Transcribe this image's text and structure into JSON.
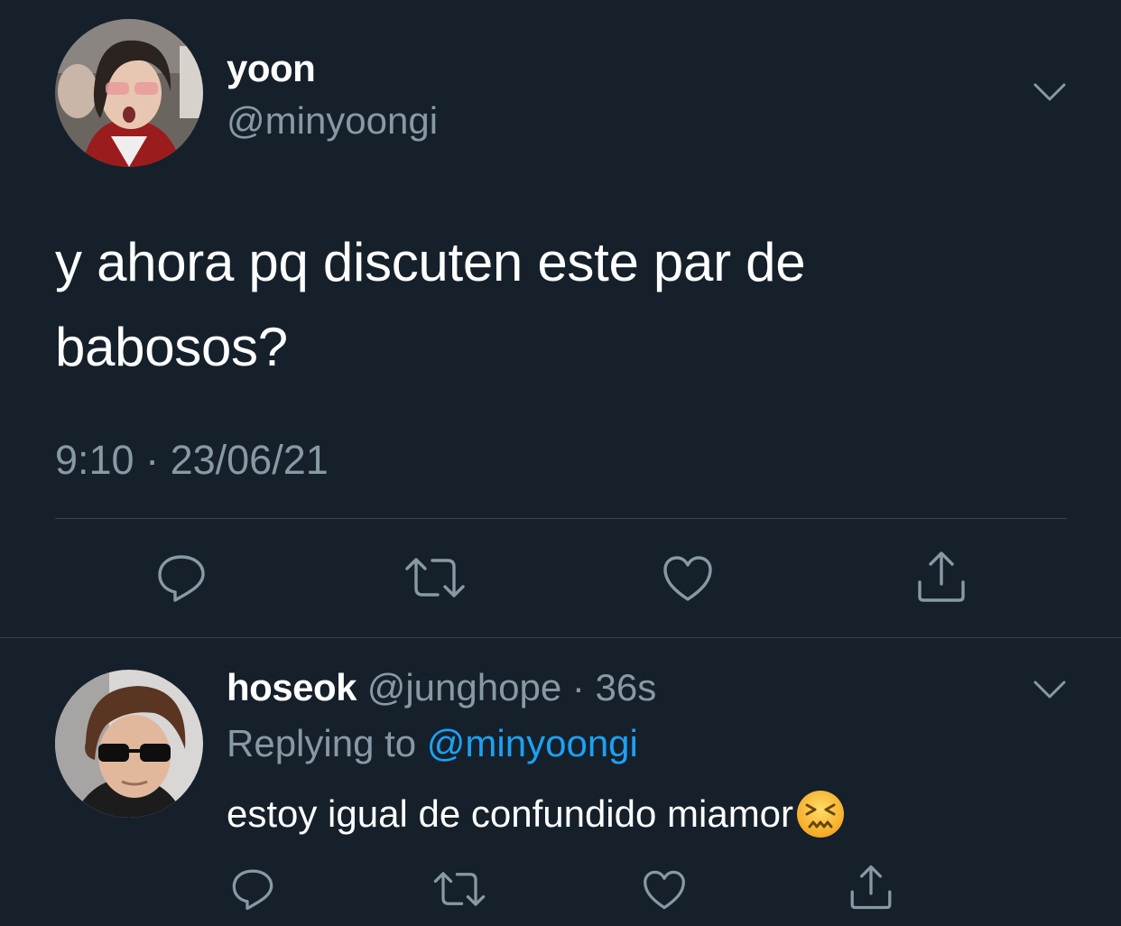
{
  "tweet": {
    "author_name": "yoon",
    "author_handle": "@minyoongi",
    "text_line1": "y ahora pq discuten este par de",
    "text_line2": "babosos?",
    "time": "9:10",
    "separator": " · ",
    "date": "23/06/21"
  },
  "reply": {
    "author_name": "hoseok",
    "author_handle": "@junghope",
    "separator": " · ",
    "age": "36s",
    "replying_label": "Replying to ",
    "replying_mention": "@minyoongi",
    "text": "estoy igual de confundido miamor",
    "emoji": "confounded-face"
  },
  "colors": {
    "background": "#15202b",
    "secondary_text": "#8899a6",
    "mention": "#1da1f2",
    "divider": "#38444d"
  },
  "icons": [
    "chevron-down-icon",
    "reply-icon",
    "retweet-icon",
    "like-icon",
    "share-icon"
  ]
}
